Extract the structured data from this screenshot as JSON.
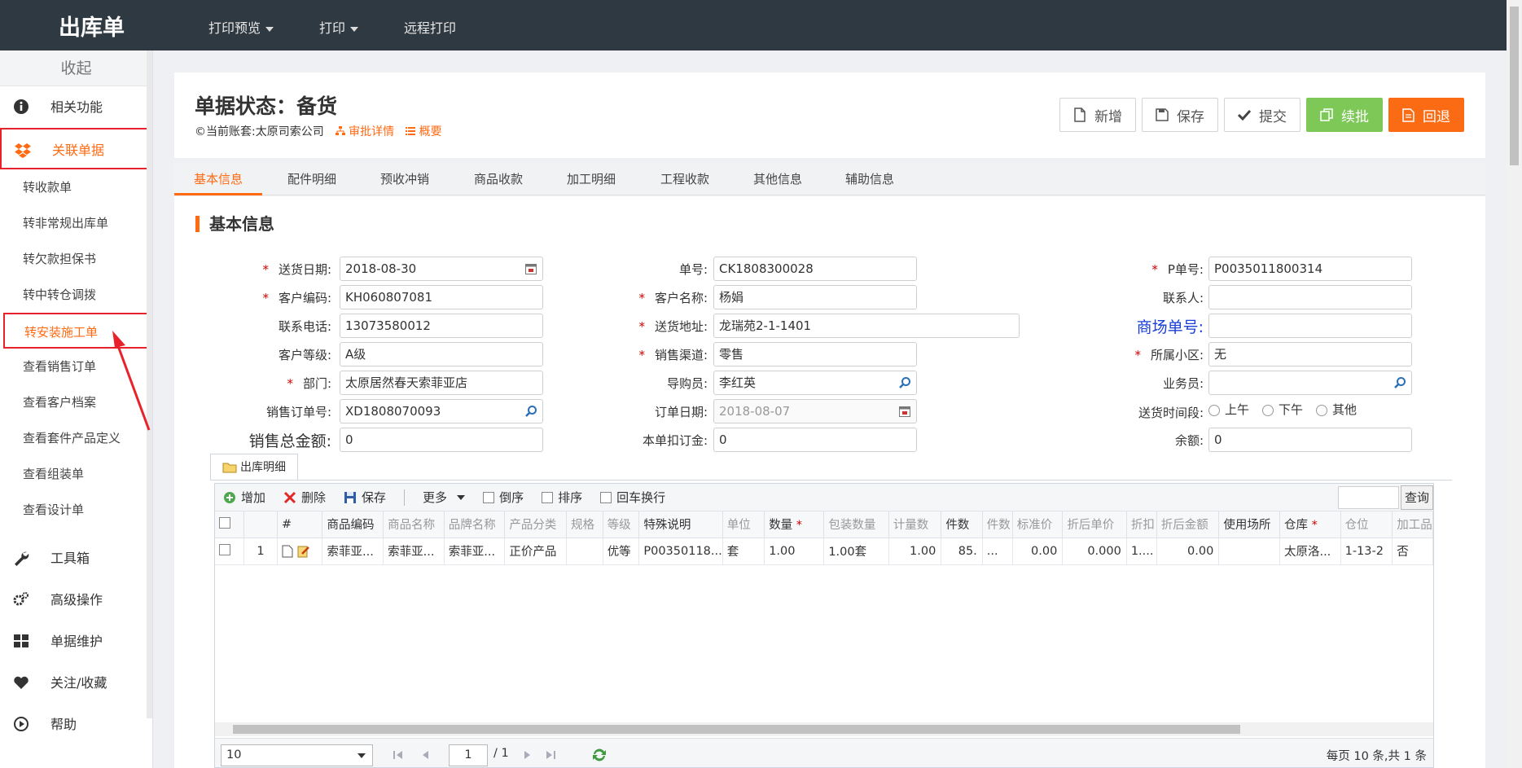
{
  "topbar": {
    "title": "出库单",
    "menu": [
      {
        "label": "打印预览",
        "dropdown": true
      },
      {
        "label": "打印",
        "dropdown": true
      },
      {
        "label": "远程打印",
        "dropdown": false
      }
    ]
  },
  "sidebar": {
    "collapse_label": "收起",
    "items": [
      {
        "label": "相关功能",
        "icon": "info-icon"
      },
      {
        "label": "关联单据",
        "icon": "dropbox-icon",
        "active": true
      }
    ],
    "sub_items": [
      "转收款单",
      "转非常规出库单",
      "转欠款担保书",
      "转中转仓调拨",
      "转安装施工单",
      "查看销售订单",
      "查看客户档案",
      "查看套件产品定义",
      "查看组装单",
      "查看设计单"
    ],
    "bottom_items": [
      {
        "label": "工具箱",
        "icon": "wrench-icon"
      },
      {
        "label": "高级操作",
        "icon": "gears-icon"
      },
      {
        "label": "单据维护",
        "icon": "grid-icon"
      },
      {
        "label": "关注/收藏",
        "icon": "heart-icon"
      },
      {
        "label": "帮助",
        "icon": "play-circle-icon"
      }
    ]
  },
  "header": {
    "status_title": "单据状态：备货",
    "account": "©当前账套:太原司索公司",
    "approval_link": "审批详情",
    "summary_link": "概要",
    "buttons": {
      "new": "新增",
      "save": "保存",
      "submit": "提交",
      "continue": "续批",
      "reject": "回退"
    },
    "colors": {
      "accent": "#ff6a13",
      "green": "#7dc856",
      "topbar": "#2f3941"
    }
  },
  "tabs": [
    "基本信息",
    "配件明细",
    "预收冲销",
    "商品收款",
    "加工明细",
    "工程收款",
    "其他信息",
    "辅助信息"
  ],
  "section_title": "基本信息",
  "form": {
    "delivery_date": {
      "label": "送货日期:",
      "value": "2018-08-30"
    },
    "customer_code": {
      "label": "客户编码:",
      "value": "KH060807081"
    },
    "phone": {
      "label": "联系电话:",
      "value": "13073580012"
    },
    "customer_level": {
      "label": "客户等级:",
      "value": "A级"
    },
    "department": {
      "label": "部门:",
      "value": "太原居然春天索菲亚店"
    },
    "sales_order_no": {
      "label": "销售订单号:",
      "value": "XD1808070093"
    },
    "sales_total": {
      "label": "销售总金额:",
      "value": "0"
    },
    "doc_no": {
      "label": "单号:",
      "value": "CK1808300028"
    },
    "customer_name": {
      "label": "客户名称:",
      "value": "杨娟"
    },
    "address": {
      "label": "送货地址:",
      "value": "龙瑞苑2-1-1401"
    },
    "channel": {
      "label": "销售渠道:",
      "value": "零售"
    },
    "guide": {
      "label": "导购员:",
      "value": "李红英"
    },
    "order_date": {
      "label": "订单日期:",
      "value": "2018-08-07"
    },
    "deduct_deposit": {
      "label": "本单扣订金:",
      "value": "0"
    },
    "p_no": {
      "label": "P单号:",
      "value": "P0035011800314"
    },
    "contact": {
      "label": "联系人:",
      "value": ""
    },
    "mall_no": {
      "label": "商场单号:",
      "value": ""
    },
    "community": {
      "label": "所属小区:",
      "value": "无"
    },
    "salesman": {
      "label": "业务员:",
      "value": ""
    },
    "time_slot": {
      "label": "送货时间段:",
      "options": [
        "上午",
        "下午",
        "其他"
      ]
    },
    "balance": {
      "label": "余额:",
      "value": "0"
    }
  },
  "grid": {
    "tab_label": "出库明细",
    "toolbar": {
      "add": "增加",
      "delete": "删除",
      "save": "保存",
      "more": "更多",
      "reverse": "倒序",
      "sort": "排序",
      "enter_wrap": "回车换行",
      "query": "查询"
    },
    "columns": [
      "",
      "",
      "#",
      "商品编码",
      "商品名称",
      "品牌名称",
      "产品分类",
      "规格",
      "等级",
      "特殊说明",
      "单位",
      "数量",
      "包装数量",
      "计量数",
      "件数",
      "件数",
      "标准价",
      "折后单价",
      "折扣",
      "折后金额",
      "使用场所",
      "仓库",
      "仓位",
      "加工品"
    ],
    "rows": [
      [
        "1",
        "索菲亚...",
        "索菲亚...",
        "索菲亚...",
        "正价产品",
        "",
        "优等",
        "P00350118...",
        "套",
        "1.00",
        "1.00套",
        "1.00",
        "85.",
        "...",
        "0.00",
        "0.000",
        "1....",
        "0.00",
        "",
        "太原洛...",
        "1-13-2",
        "否"
      ]
    ],
    "pager": {
      "page_size": "10",
      "page": "1",
      "total_pages": "/ 1",
      "info": "每页 10 条,共 1 条"
    }
  }
}
